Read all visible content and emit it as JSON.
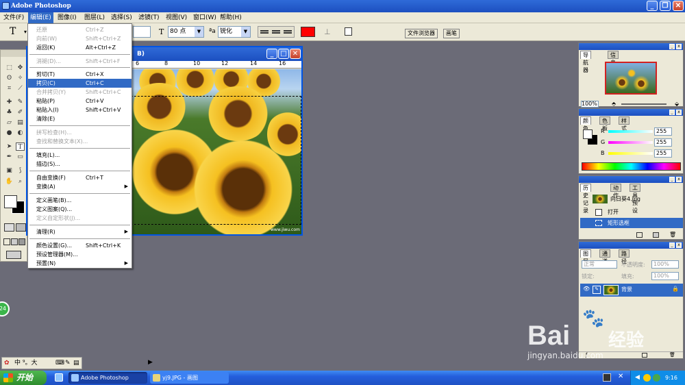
{
  "app": {
    "title": "Adobe Photoshop"
  },
  "menubar": [
    {
      "label": "文件(F)"
    },
    {
      "label": "编辑(E)"
    },
    {
      "label": "图像(I)"
    },
    {
      "label": "图层(L)"
    },
    {
      "label": "选择(S)"
    },
    {
      "label": "滤镜(T)"
    },
    {
      "label": "视图(V)"
    },
    {
      "label": "窗口(W)"
    },
    {
      "label": "帮助(H)"
    }
  ],
  "options": {
    "tool_glyph": "T",
    "font_size": "80 点",
    "aa_label": "ªa",
    "antialias": "锐化",
    "text_color": "#ff0000",
    "file_browser_tab": "文件浏览器",
    "brushes_tab": "画笔"
  },
  "document": {
    "title_suffix": "B)",
    "ruler_numbers": [
      "6",
      "8",
      "10",
      "12",
      "14",
      "16"
    ],
    "image_caption": "www.jiwu.com"
  },
  "edit_menu": [
    {
      "label": "还原",
      "shortcut": "Ctrl+Z",
      "disabled": true
    },
    {
      "label": "向前(W)",
      "shortcut": "Shift+Ctrl+Z",
      "disabled": true
    },
    {
      "label": "返回(K)",
      "shortcut": "Alt+Ctrl+Z",
      "disabled": false
    },
    {
      "label": "消褪(D)...",
      "shortcut": "Shift+Ctrl+F",
      "disabled": true
    },
    {
      "label": "剪切(T)",
      "shortcut": "Ctrl+X",
      "disabled": false
    },
    {
      "label": "拷贝(C)",
      "shortcut": "Ctrl+C",
      "disabled": false,
      "highlight": true
    },
    {
      "label": "合并拷贝(Y)",
      "shortcut": "Shift+Ctrl+C",
      "disabled": true
    },
    {
      "label": "粘贴(P)",
      "shortcut": "Ctrl+V",
      "disabled": false
    },
    {
      "label": "粘贴入(I)",
      "shortcut": "Shift+Ctrl+V",
      "disabled": false
    },
    {
      "label": "清除(E)",
      "shortcut": "",
      "disabled": false
    },
    {
      "label": "拼写检查(H)...",
      "shortcut": "",
      "disabled": true
    },
    {
      "label": "查找和替换文本(X)...",
      "shortcut": "",
      "disabled": true
    },
    {
      "label": "填充(L)...",
      "shortcut": "",
      "disabled": false
    },
    {
      "label": "描边(S)...",
      "shortcut": "",
      "disabled": false
    },
    {
      "label": "自由变换(F)",
      "shortcut": "Ctrl+T",
      "disabled": false
    },
    {
      "label": "变换(A)",
      "shortcut": "",
      "disabled": false,
      "submenu": true
    },
    {
      "label": "定义画笔(B)...",
      "shortcut": "",
      "disabled": false
    },
    {
      "label": "定义图案(Q)...",
      "shortcut": "",
      "disabled": false
    },
    {
      "label": "定义自定形状(J)...",
      "shortcut": "",
      "disabled": true
    },
    {
      "label": "清理(R)",
      "shortcut": "",
      "disabled": false,
      "submenu": true
    },
    {
      "label": "颜色设置(G)...",
      "shortcut": "Shift+Ctrl+K",
      "disabled": false
    },
    {
      "label": "预设管理器(M)...",
      "shortcut": "",
      "disabled": false
    },
    {
      "label": "预置(N)",
      "shortcut": "",
      "disabled": false,
      "submenu": true
    }
  ],
  "navigator": {
    "tabs": [
      "导航器",
      "信息"
    ],
    "zoom": "100%"
  },
  "color_panel": {
    "tabs": [
      "颜色",
      "色板",
      "样式"
    ],
    "r_label": "R",
    "g_label": "G",
    "b_label": "B",
    "r": "255",
    "g": "255",
    "b": "255"
  },
  "history_panel": {
    "tabs": [
      "历史记录",
      "动作",
      "工具预设"
    ],
    "snapshot": "向日葵4.jpg",
    "steps": [
      "打开",
      "矩形选框"
    ]
  },
  "layers_panel": {
    "tabs": [
      "图层",
      "通道",
      "路径"
    ],
    "blend_mode": "正常",
    "opacity_label": "不透明度:",
    "opacity": "100%",
    "lock_label": "锁定:",
    "fill_label": "填充:",
    "fill": "100%",
    "layer_name": "背景"
  },
  "lang_bar": {
    "text": "中 ⁹。大"
  },
  "taskbar": {
    "start": "开始",
    "tasks": [
      {
        "label": "Adobe Photoshop"
      },
      {
        "label": "yj9.JPG - 画图"
      }
    ],
    "clock": "9:16"
  },
  "floating_badge": "24",
  "watermark": {
    "brand": "Bai",
    "cn": "经验",
    "url": "jingyan.baidu.com"
  }
}
